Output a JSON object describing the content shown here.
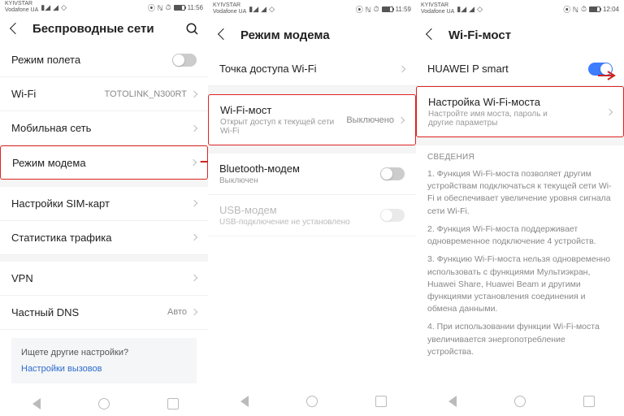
{
  "status": {
    "carrier_top": "KYIVSTAR",
    "carrier_bottom": "Vodafone UA",
    "time1": "11:56",
    "time2": "11:59",
    "time3": "12:04"
  },
  "p1": {
    "title": "Беспроводные сети",
    "airplane": "Режим полета",
    "wifi": "Wi-Fi",
    "wifi_val": "TOTOLINK_N300RT",
    "mobile": "Мобильная сеть",
    "tether": "Режим модема",
    "sim": "Настройки SIM-карт",
    "traffic": "Статистика трафика",
    "vpn": "VPN",
    "dns": "Частный DNS",
    "dns_val": "Авто",
    "info_q": "Ищете другие настройки?",
    "info_link": "Настройки вызовов"
  },
  "p2": {
    "title": "Режим модема",
    "hotspot": "Точка доступа Wi-Fi",
    "bridge": "Wi-Fi-мост",
    "bridge_sub": "Открыт доступ к текущей сети Wi-Fi",
    "bridge_val": "Выключено",
    "bt": "Bluetooth-модем",
    "bt_sub": "Выключен",
    "usb": "USB-модем",
    "usb_sub": "USB-подключение не установлено"
  },
  "p3": {
    "title": "Wi-Fi-мост",
    "device": "HUAWEI P smart",
    "config": "Настройка Wi-Fi-моста",
    "config_sub": "Настройте имя моста, пароль и другие параметры",
    "section": "СВЕДЕНИЯ",
    "d1": "1. Функция Wi-Fi-моста позволяет другим устройствам подключаться к текущей сети Wi-Fi и обеспечивает увеличение уровня сигнала сети Wi-Fi.",
    "d2": "2. Функция Wi-Fi-моста поддерживает одновременное подключение 4 устройств.",
    "d3": "3. Функцию Wi-Fi-моста нельзя одновременно использовать с функциями Мультиэкран, Huawei Share, Huawei Beam и другими функциями установления соединения и обмена данными.",
    "d4": "4. При использовании функции Wi-Fi-моста увеличивается энергопотребление устройства."
  }
}
